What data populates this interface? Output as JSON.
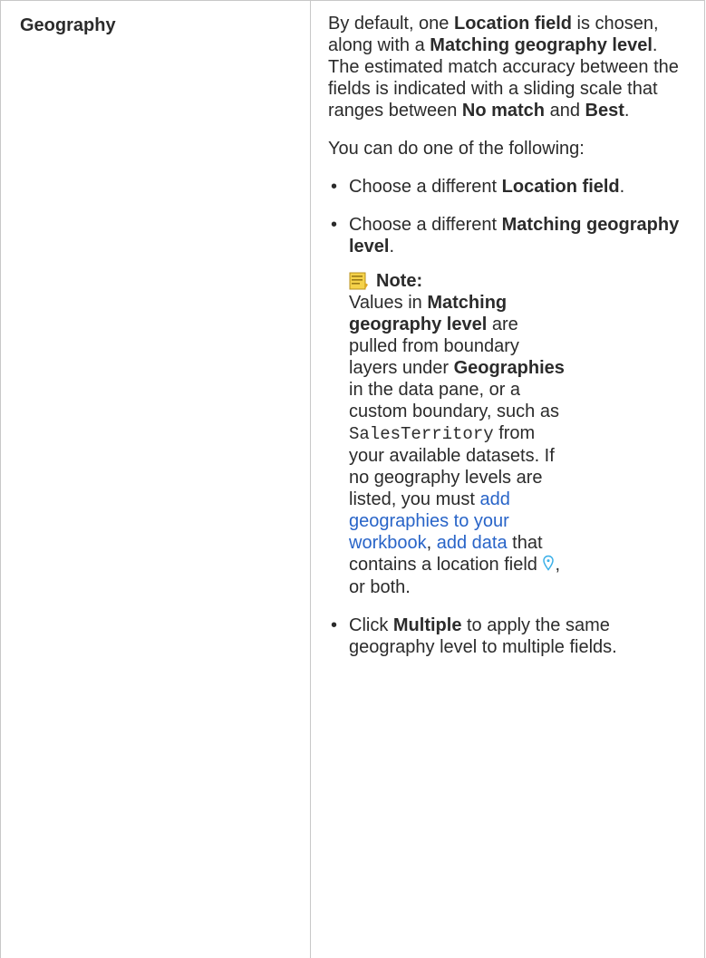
{
  "row": {
    "term": "Geography",
    "intro": {
      "t1": "By default, one ",
      "b1": "Location field",
      "t2": " is chosen, along with a ",
      "b2": "Matching geography level",
      "t3": ". The estimated match accuracy between the fields is indicated with a sliding scale that ranges between ",
      "b3": "No match",
      "t4": " and ",
      "b4": "Best",
      "t5": "."
    },
    "sub": "You can do one of the following:",
    "bullet_char": "•",
    "item1": {
      "t1": "Choose a different ",
      "b1": "Location field",
      "t2": "."
    },
    "item2": {
      "t1": "Choose a different ",
      "b1": "Matching geography level",
      "t2": "."
    },
    "note": {
      "label": "Note:",
      "t1": "Values in ",
      "b1": "Matching geography level",
      "t2": " are pulled from boundary layers under ",
      "b2": "Geographies",
      "t3": " in the data pane, or a custom boundary, such as ",
      "code": "SalesTerritory",
      "t4": " from your available datasets. If no geography levels are listed, you must ",
      "link1": "add geographies to your workbook",
      "t5": ", ",
      "link2": "add data",
      "t6": " that contains a location field ",
      "t7": ", or both.",
      "icon": "note-icon",
      "location_icon": "location-field-icon"
    },
    "item3": {
      "t1": "Click ",
      "b1": "Multiple",
      "t2": " to apply the same geography level to multiple fields."
    }
  },
  "colors": {
    "link": "#2864c8",
    "border": "#c8c8c8",
    "text": "#2b2b2b",
    "location_icon": "#3cb0e8"
  }
}
